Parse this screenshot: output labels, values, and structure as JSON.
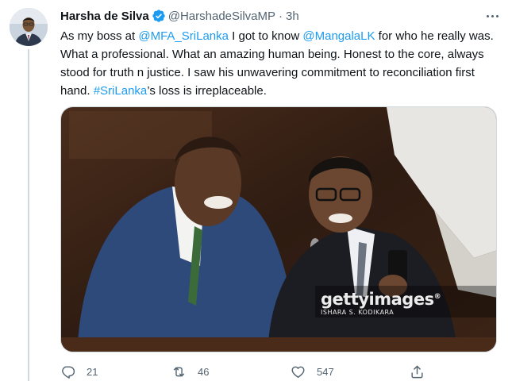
{
  "tweet": {
    "author": {
      "display_name": "Harsha de Silva",
      "handle": "@HarshadeSilvaMP",
      "verified": true
    },
    "separator": "·",
    "time": "3h",
    "text_segments": [
      {
        "type": "text",
        "value": "As my boss at "
      },
      {
        "type": "link",
        "value": "@MFA_SriLanka"
      },
      {
        "type": "text",
        "value": " I got to know "
      },
      {
        "type": "link",
        "value": "@MangalaLK"
      },
      {
        "type": "text",
        "value": " for who he really was. What a professional. What an amazing human being. Honest to the core, always stood for truth n justice. I saw his unwavering commitment to reconciliation first hand. "
      },
      {
        "type": "link",
        "value": "#SriLanka"
      },
      {
        "type": "text",
        "value": "’s loss is irreplaceable."
      }
    ],
    "media": {
      "watermark_logo": "gettyimages",
      "watermark_mark": "®",
      "watermark_credit": "ISHARA S. KODIKARA"
    },
    "actions": {
      "reply": {
        "icon": "reply-icon",
        "count": "21"
      },
      "retweet": {
        "icon": "retweet-icon",
        "count": "46"
      },
      "like": {
        "icon": "heart-icon",
        "count": "547"
      },
      "share": {
        "icon": "share-icon"
      }
    },
    "colors": {
      "link": "#1d9bf0",
      "verified": "#1d9bf0",
      "secondary_text": "#536471"
    }
  }
}
